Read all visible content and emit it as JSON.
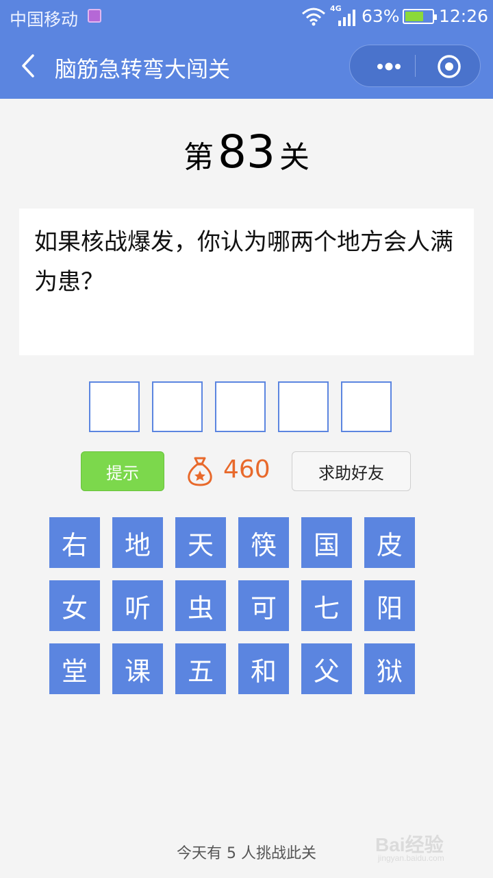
{
  "status_bar": {
    "carrier": "中国移动",
    "network": "4G",
    "battery": "63%",
    "time": "12:26"
  },
  "nav": {
    "title": "脑筋急转弯大闯关"
  },
  "level": {
    "prefix": "第",
    "number": "83",
    "suffix": "关"
  },
  "question": "如果核战爆发，你认为哪两个地方会人满为患？",
  "answer_slots": [
    "",
    "",
    "",
    "",
    ""
  ],
  "controls": {
    "hint_label": "提示",
    "coins": "460",
    "help_label": "求助好友"
  },
  "characters": [
    [
      "右",
      "地",
      "天",
      "筷",
      "国",
      "皮"
    ],
    [
      "女",
      "听",
      "虫",
      "可",
      "七",
      "阳"
    ],
    [
      "堂",
      "课",
      "五",
      "和",
      "父",
      "狱"
    ]
  ],
  "footer": "今天有 5 人挑战此关",
  "watermark": {
    "text": "Bai经验",
    "sub": "jingyan.baidu.com"
  },
  "colors": {
    "primary": "#5b85e0",
    "hint_green": "#7cd84c",
    "coin_orange": "#e8692b"
  }
}
